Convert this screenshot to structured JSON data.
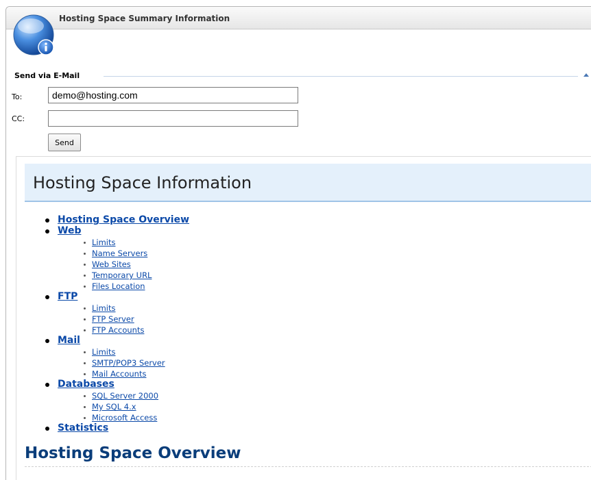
{
  "window": {
    "title": "Hosting Space Summary Information"
  },
  "email": {
    "section_title": "Send via E-Mail",
    "to_label": "To:",
    "to_value": "demo@hosting.com",
    "cc_label": "CC:",
    "cc_value": "",
    "send_label": "Send"
  },
  "report": {
    "title": "Hosting Space Information",
    "toc": [
      {
        "label": "Hosting Space Overview",
        "items": []
      },
      {
        "label": "Web",
        "items": [
          "Limits",
          "Name Servers",
          "Web Sites",
          "Temporary URL",
          "Files Location"
        ]
      },
      {
        "label": "FTP",
        "items": [
          "Limits",
          "FTP Server",
          "FTP Accounts"
        ]
      },
      {
        "label": "Mail",
        "items": [
          "Limits",
          "SMTP/POP3 Server",
          "Mail Accounts"
        ]
      },
      {
        "label": "Databases",
        "items": [
          "SQL Server 2000",
          "My SQL 4.x",
          "Microsoft Access"
        ]
      },
      {
        "label": "Statistics",
        "items": []
      }
    ],
    "overview_heading": "Hosting Space Overview"
  },
  "colors": {
    "link": "#0b49a8",
    "header_bg": "#e4f0fb",
    "heading": "#0a3d7a"
  },
  "icons": {
    "window_icon": "info-icon",
    "collapse": "collapse-arrow-icon"
  }
}
